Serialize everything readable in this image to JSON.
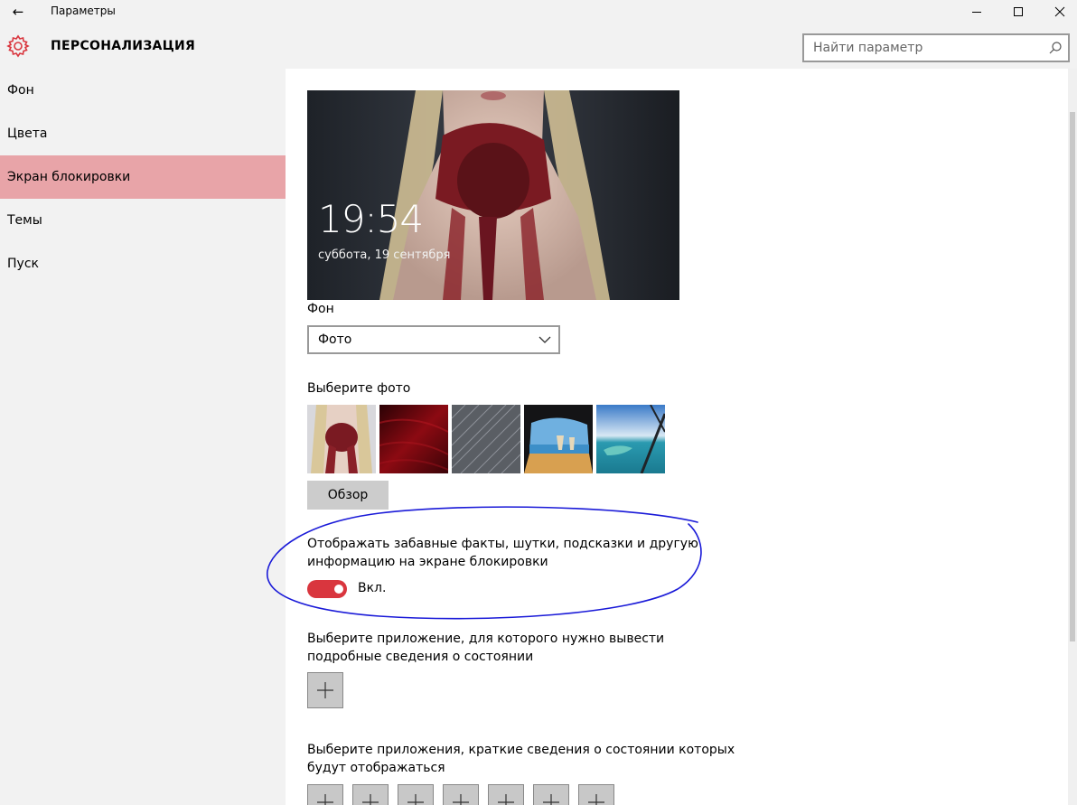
{
  "window": {
    "title": "Параметры",
    "back_glyph": "←"
  },
  "header": {
    "title": "ПЕРСОНАЛИЗАЦИЯ",
    "search_placeholder": "Найти параметр"
  },
  "sidebar": {
    "items": [
      {
        "label": "Фон",
        "active": false
      },
      {
        "label": "Цвета",
        "active": false
      },
      {
        "label": "Экран блокировки",
        "active": true
      },
      {
        "label": "Темы",
        "active": false
      },
      {
        "label": "Пуск",
        "active": false
      }
    ]
  },
  "content": {
    "preview": {
      "time": "19:54",
      "date": "суббота, 19 сентября"
    },
    "background": {
      "label": "Фон",
      "selected": "Фото"
    },
    "photos": {
      "label": "Выберите фото",
      "browse_label": "Обзор"
    },
    "fun_facts": {
      "line1": "Отображать забавные факты, шутки, подсказки и другую",
      "line2": "информацию на экране блокировки",
      "toggle_label": "Вкл.",
      "enabled": true
    },
    "detailed_status": {
      "line1": "Выберите приложение, для которого нужно вывести",
      "line2": "подробные сведения о состоянии"
    },
    "quick_status": {
      "line1": "Выберите приложения, краткие сведения о состоянии которых",
      "line2": "будут отображаться"
    }
  },
  "colors": {
    "accent": "#d9363e",
    "active_nav": "#e8a4a8",
    "annotation": "#1a1ad8"
  }
}
